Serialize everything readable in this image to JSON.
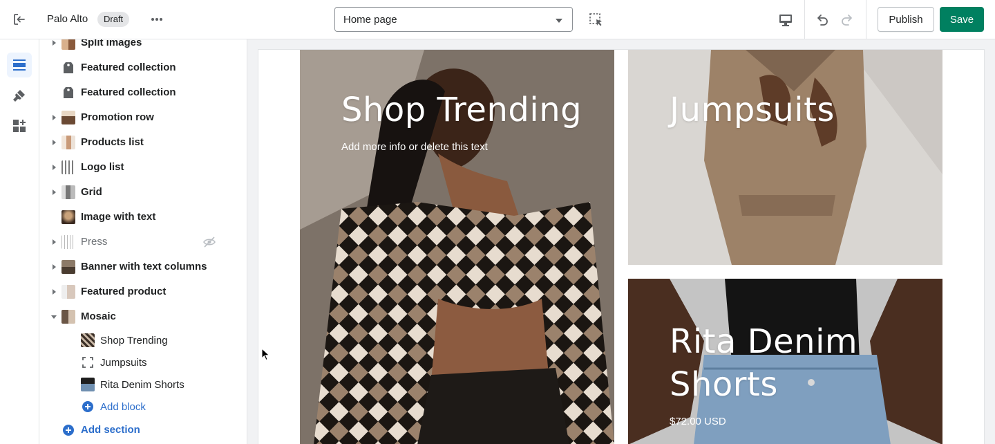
{
  "topbar": {
    "store_name": "Palo Alto",
    "status_badge": "Draft",
    "page_select_value": "Home page",
    "publish_label": "Publish",
    "save_label": "Save"
  },
  "sections": [
    {
      "label": "Split images",
      "expandable": true
    },
    {
      "label": "Featured collection",
      "expandable": false
    },
    {
      "label": "Featured collection",
      "expandable": false
    },
    {
      "label": "Promotion row",
      "expandable": true
    },
    {
      "label": "Products list",
      "expandable": true
    },
    {
      "label": "Logo list",
      "expandable": true
    },
    {
      "label": "Grid",
      "expandable": true
    },
    {
      "label": "Image with text",
      "expandable": false
    },
    {
      "label": "Press",
      "expandable": true,
      "hidden": true
    },
    {
      "label": "Banner with text columns",
      "expandable": true
    },
    {
      "label": "Featured product",
      "expandable": true
    },
    {
      "label": "Mosaic",
      "expandable": true,
      "expanded": true
    }
  ],
  "mosaic_blocks": [
    {
      "label": "Shop Trending"
    },
    {
      "label": "Jumpsuits"
    },
    {
      "label": "Rita Denim Shorts"
    }
  ],
  "add_block_label": "Add block",
  "add_section_label": "Add section",
  "preview": {
    "tile1": {
      "title": "Shop Trending",
      "subtitle": "Add more info or delete this text"
    },
    "tile2": {
      "title": "Jumpsuits"
    },
    "tile3": {
      "title_line1": "Rita Denim",
      "title_line2": "Shorts",
      "price": "$72.00 USD"
    }
  },
  "colors": {
    "accent": "#2c6ecb",
    "save_green": "#008060"
  }
}
